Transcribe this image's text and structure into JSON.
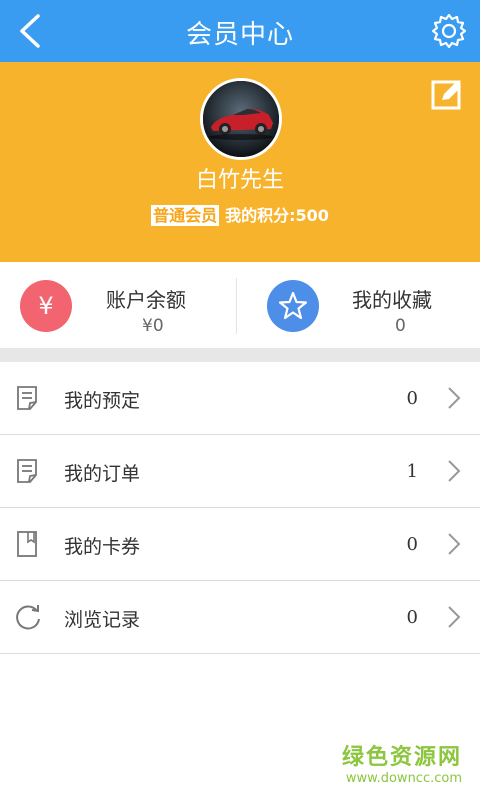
{
  "header": {
    "title": "会员中心",
    "back_icon": "chevron-left-icon",
    "settings_icon": "gear-icon"
  },
  "profile": {
    "username": "白竹先生",
    "member_level": "普通会员",
    "points_text": "我的积分:500",
    "edit_icon": "edit-icon",
    "avatar": "car-avatar"
  },
  "stats": {
    "balance": {
      "label": "账户余额",
      "value": "¥0",
      "icon_text": "¥"
    },
    "favorites": {
      "label": "我的收藏",
      "value": "0",
      "icon": "star-icon"
    }
  },
  "list": [
    {
      "label": "我的预定",
      "count": "0",
      "icon": "document-icon"
    },
    {
      "label": "我的订单",
      "count": "1",
      "icon": "document-icon"
    },
    {
      "label": "我的卡券",
      "count": "0",
      "icon": "card-icon"
    },
    {
      "label": "浏览记录",
      "count": "0",
      "icon": "history-icon"
    }
  ],
  "watermark": {
    "main": "绿色资源网",
    "sub": "www.downcc.com"
  },
  "colors": {
    "topbar": "#3a9cf0",
    "profile_bg": "#f7b32c",
    "balance_icon": "#f26470",
    "favorites_icon": "#4d8ee8"
  }
}
